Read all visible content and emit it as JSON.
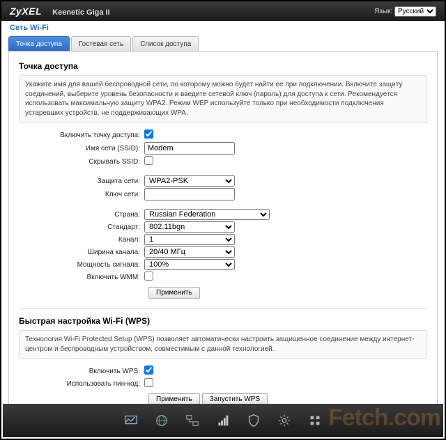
{
  "header": {
    "brand": "ZyXEL",
    "model": "Keenetic Giga II",
    "lang_label": "Язык:",
    "lang_value": "Русский"
  },
  "breadcrumb": "Сеть Wi-Fi",
  "tabs": [
    {
      "label": "Точка доступа",
      "active": true
    },
    {
      "label": "Гостевая сеть",
      "active": false
    },
    {
      "label": "Список доступа",
      "active": false
    }
  ],
  "ap": {
    "title": "Точка доступа",
    "info": "Укажите имя для вашей беспроводной сети, по которому можно будет найти ее при подключении. Включите защиту соединений, выберите уровень безопасности и введите сетевой ключ (пароль) для доступа к сети. Рекомендуется использовать максимальную защиту WPA2. Режим WEP используйте только при необходимости подключения устаревших устройств, не поддерживающих WPA.",
    "fields": {
      "enable_label": "Включить точку доступа:",
      "enable_checked": true,
      "ssid_label": "Имя сети (SSID):",
      "ssid_value": "Modem",
      "hide_label": "Скрывать SSID:",
      "hide_checked": false,
      "security_label": "Защита сети:",
      "security_value": "WPA2-PSK",
      "key_label": "Ключ сети:",
      "key_value": "",
      "country_label": "Страна:",
      "country_value": "Russian Federation",
      "standard_label": "Стандарт:",
      "standard_value": "802.11bgn",
      "channel_label": "Канал:",
      "channel_value": "1",
      "width_label": "Ширина канала:",
      "width_value": "20/40 МГц",
      "power_label": "Мощность сигнала:",
      "power_value": "100%",
      "wmm_label": "Включить WMM:",
      "wmm_checked": false
    },
    "apply": "Применить"
  },
  "wps": {
    "title": "Быстрая настройка Wi-Fi (WPS)",
    "info": "Технология Wi-Fi Protected Setup (WPS) позволяет автоматически настроить защищенное соединение между интернет-центром и беспроводным устройством, совместимым с данной технологией.",
    "enable_label": "Включить WPS:",
    "enable_checked": true,
    "pin_label": "Использовать пин-код:",
    "pin_checked": false,
    "apply": "Применить",
    "start": "Запустить WPS"
  },
  "watermark": "Fetch.com"
}
